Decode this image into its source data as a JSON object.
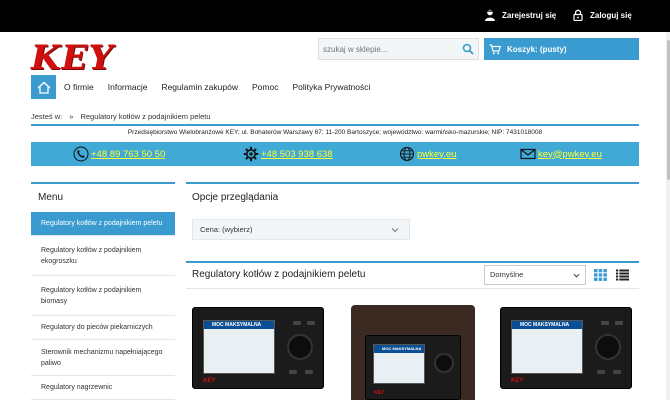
{
  "header": {
    "register_label": "Zarejestruj się",
    "login_label": "Zaloguj się",
    "logo_text": "KEY",
    "search_placeholder": "szukaj w sklepie...",
    "cart_label": "Koszyk: (pusty)"
  },
  "nav": {
    "home_icon": "home-icon",
    "items": [
      "O firmie",
      "Informacje",
      "Regulamin zakupów",
      "Pomoc",
      "Polityka Prywatności"
    ]
  },
  "breadcrumb": {
    "prefix": "Jesteś w:",
    "separator": "»",
    "current": "Regulatory kotłów z podajnikiem peletu"
  },
  "company_info": "Przedsiębiorstwo Wielobranżowe KEY; ul. Bohaterów Warszawy 67; 11-200 Bartoszyce; województwo: warmińsko-mazurskie; NIP: 7431018008",
  "contacts": [
    {
      "icon": "phone-icon",
      "text": "+48 89 763 50 50"
    },
    {
      "icon": "gear-icon",
      "text": "+48 503 938 638"
    },
    {
      "icon": "globe-icon",
      "text": "pwkey.eu"
    },
    {
      "icon": "mail-icon",
      "text": "key@pwkey.eu"
    }
  ],
  "sidebar": {
    "title": "Menu",
    "items": [
      {
        "label": "Regulatory kotłów z podajnikiem peletu",
        "active": true
      },
      {
        "label": "Regulatory kotłów z podajnikiem ekogroszku",
        "active": false
      },
      {
        "label": "Regulatory kotłów z podajnikiem biomasy",
        "active": false
      },
      {
        "label": "Regulatory do pieców piekarniczych",
        "active": false
      },
      {
        "label": "Sterownik mechanizmu napełniającego paliwo",
        "active": false
      },
      {
        "label": "Regulatory nagrzewnic",
        "active": false
      }
    ]
  },
  "browse": {
    "title": "Opcje przeglądania",
    "price_filter": "Cena: (wybierz)"
  },
  "category": {
    "title": "Regulatory kotłów z podajnikiem peletu",
    "sort_value": "Domyślne"
  },
  "products": [
    {
      "screen_title": "MOC MAKSYMALNA",
      "brand": "KEY"
    },
    {
      "screen_title": "MOC MAKSYMALNA",
      "brand": "KEY"
    },
    {
      "screen_title": "MOC MAKSYMALNA",
      "brand": "KEY"
    }
  ],
  "colors": {
    "accent": "#3a9bd0",
    "contact_bar": "#40a9d6",
    "link_yellow": "#ffff33",
    "logo_red": "#d10f0f"
  }
}
